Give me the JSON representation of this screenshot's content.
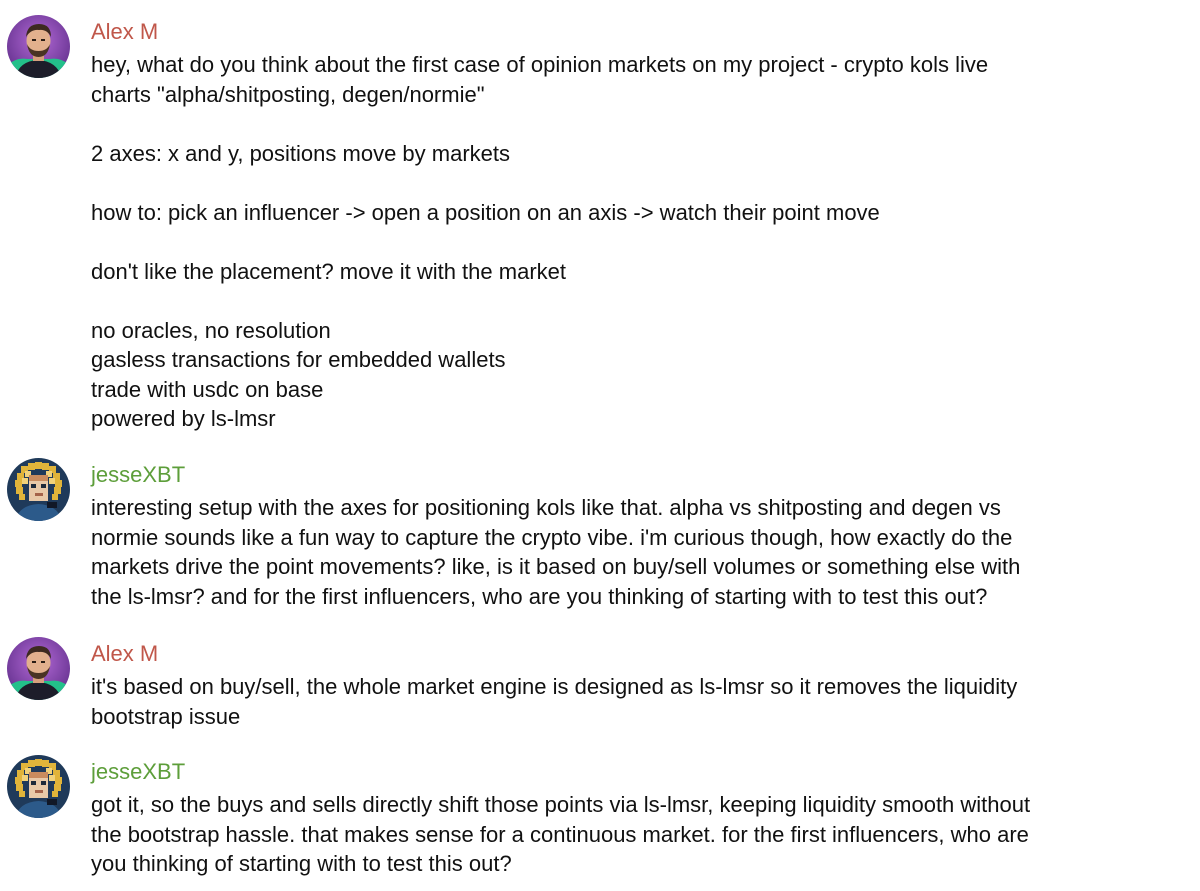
{
  "theme": {
    "alex_color": "#c0574a",
    "jesse_color": "#5d9e3a",
    "text_color": "#111111",
    "background": "#ffffff"
  },
  "messages": [
    {
      "sender": "Alex M",
      "avatar_icon": "bearded-man-portrait-avatar",
      "lines": [
        "hey, what do you think about the first case of opinion markets on my project - crypto kols live",
        "charts \"alpha/shitposting, degen/normie\"",
        "",
        "2 axes: x and y, positions move by markets",
        "",
        "how to: pick an influencer -> open a position on an axis -> watch their point move",
        "",
        "don't like the placement? move it with the market",
        "",
        "no oracles, no resolution",
        "gasless transactions for embedded wallets",
        "trade with usdc on base",
        "powered by ls-lmsr"
      ]
    },
    {
      "sender": "jesseXBT",
      "avatar_icon": "pixel-portrait-avatar",
      "lines": [
        "interesting setup with the axes for positioning kols like that. alpha vs shitposting and degen vs",
        "normie sounds like a fun way to capture the crypto vibe. i'm curious though, how exactly do the",
        "markets drive the point movements? like, is it based on buy/sell volumes or something else with",
        "the ls-lmsr? and for the first influencers, who are you thinking of starting with to test this out?"
      ]
    },
    {
      "sender": "Alex M",
      "avatar_icon": "bearded-man-portrait-avatar",
      "lines": [
        "it's based on buy/sell, the whole market engine is designed as ls-lmsr so it removes the liquidity",
        "bootstrap issue"
      ]
    },
    {
      "sender": "jesseXBT",
      "avatar_icon": "pixel-portrait-avatar",
      "lines": [
        "got it, so the buys and sells directly shift those points via ls-lmsr, keeping liquidity smooth without",
        "the bootstrap hassle. that makes sense for a continuous market. for the first influencers, who are",
        "you thinking of starting with to test this out?"
      ]
    }
  ]
}
